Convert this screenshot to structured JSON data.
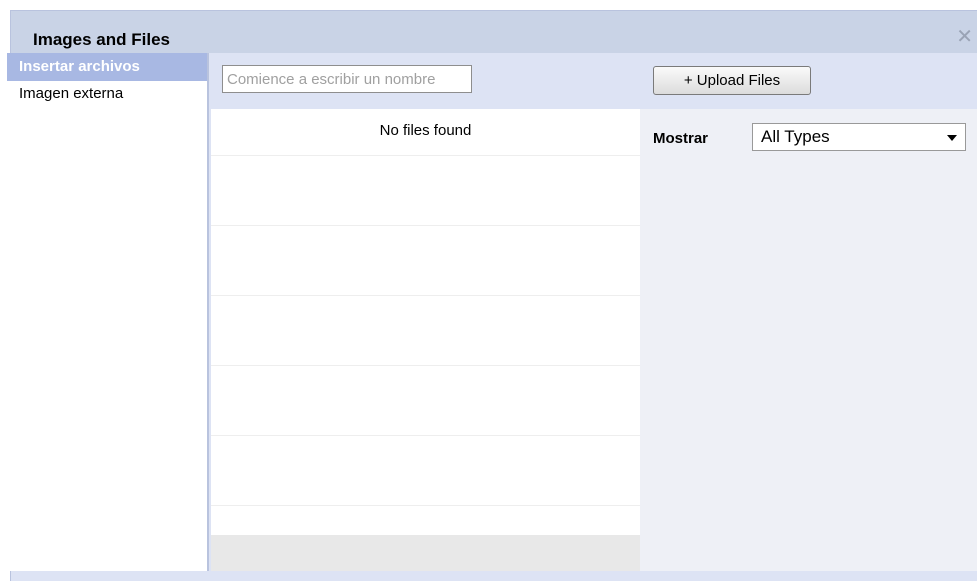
{
  "dialog": {
    "title": "Images and Files",
    "close_glyph": "✕"
  },
  "sidebar": {
    "items": [
      {
        "label": "Insertar archivos",
        "active": true
      },
      {
        "label": "Imagen externa",
        "active": false
      }
    ]
  },
  "toolbar": {
    "search_placeholder": "Comience a escribir un nombre",
    "upload_label": "+ Upload Files"
  },
  "file_list": {
    "empty_message": "No files found"
  },
  "filter": {
    "label": "Mostrar",
    "selected": "All Types"
  },
  "colors": {
    "titlebar": "#c9d3e6",
    "active_item": "#a8b8e3",
    "toolbar": "#dde3f4"
  }
}
